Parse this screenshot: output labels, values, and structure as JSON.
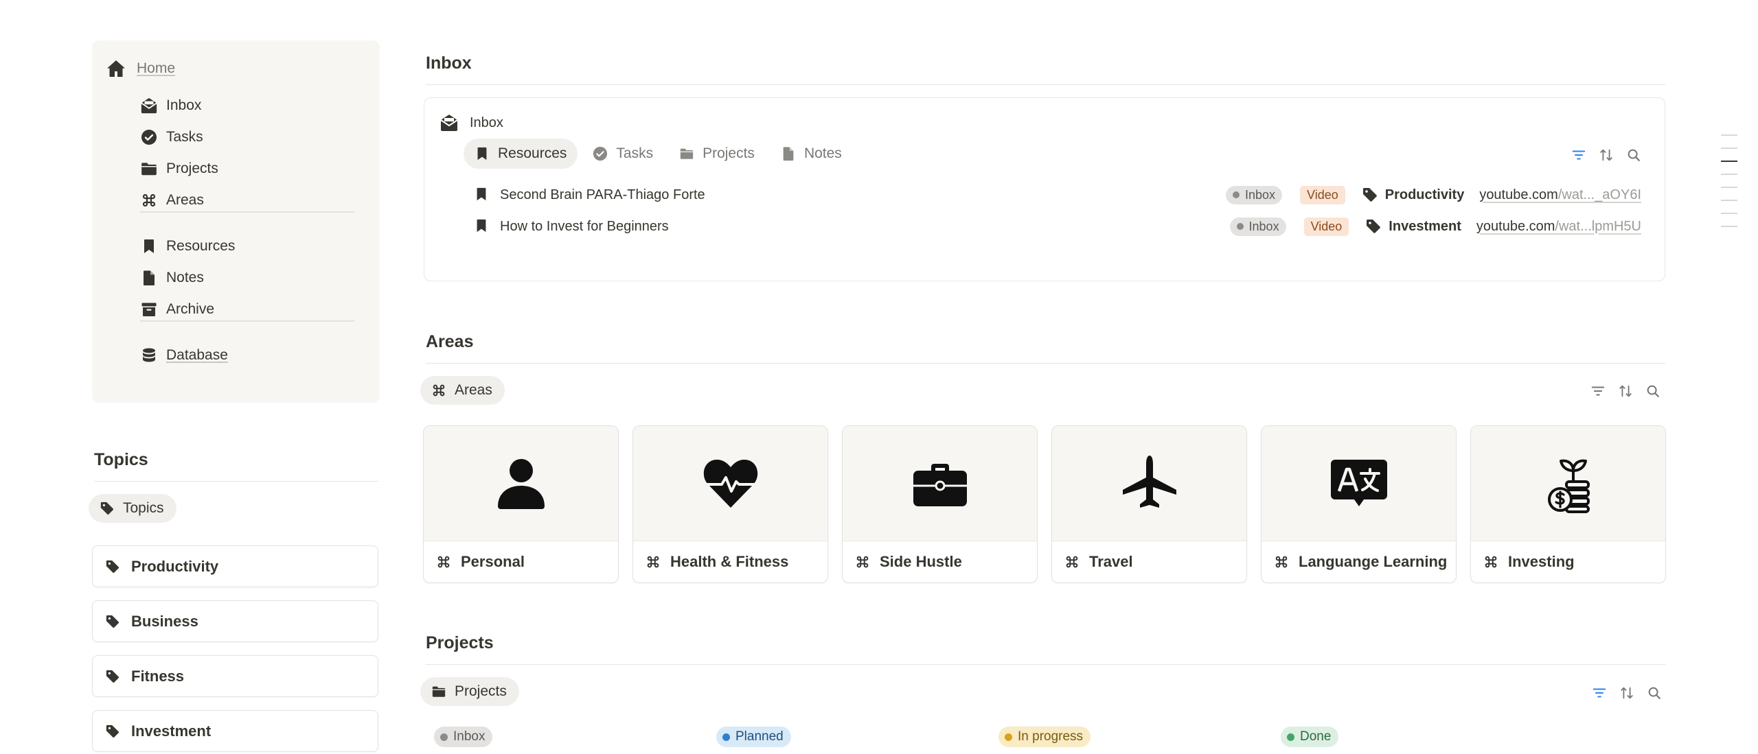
{
  "sidebar": {
    "home": "Home",
    "items": [
      {
        "label": "Inbox",
        "icon": "inbox-icon"
      },
      {
        "label": "Tasks",
        "icon": "check-circle-icon"
      },
      {
        "label": "Projects",
        "icon": "folder-icon"
      },
      {
        "label": "Areas",
        "icon": "command-icon"
      },
      {
        "label": "Resources",
        "icon": "bookmark-icon"
      },
      {
        "label": "Notes",
        "icon": "document-icon"
      },
      {
        "label": "Archive",
        "icon": "archive-icon"
      },
      {
        "label": "Database",
        "icon": "database-icon"
      }
    ]
  },
  "topics": {
    "title": "Topics",
    "view": "Topics",
    "items": [
      "Productivity",
      "Business",
      "Fitness",
      "Investment"
    ]
  },
  "inbox": {
    "title": "Inbox",
    "block_label": "Inbox",
    "tabs": [
      "Resources",
      "Tasks",
      "Projects",
      "Notes"
    ],
    "active_tab": "Resources",
    "rows": [
      {
        "title": "Second Brain PARA-Thiago Forte",
        "status": "Inbox",
        "type": "Video",
        "topic": "Productivity",
        "url_domain": "youtube.com",
        "url_rest": "/wat..._aOY6I"
      },
      {
        "title": "How to Invest for Beginners",
        "status": "Inbox",
        "type": "Video",
        "topic": "Investment",
        "url_domain": "youtube.com",
        "url_rest": "/wat...lpmH5U"
      }
    ]
  },
  "areas": {
    "title": "Areas",
    "view": "Areas",
    "cards": [
      {
        "label": "Personal",
        "icon": "person-icon"
      },
      {
        "label": "Health & Fitness",
        "icon": "heart-pulse-icon"
      },
      {
        "label": "Side Hustle",
        "icon": "briefcase-icon"
      },
      {
        "label": "Travel",
        "icon": "airplane-icon"
      },
      {
        "label": "Languange Learning",
        "icon": "translate-icon"
      },
      {
        "label": "Investing",
        "icon": "plant-coins-icon"
      }
    ]
  },
  "projects": {
    "title": "Projects",
    "view": "Projects",
    "statuses": [
      {
        "label": "Inbox",
        "bg": "#e3e2e0",
        "dot": "#8c8b88",
        "color": "#5a5955"
      },
      {
        "label": "Planned",
        "bg": "#d8e9f7",
        "dot": "#2f7fd1",
        "color": "#1f4f7d"
      },
      {
        "label": "In progress",
        "bg": "#f9ebc4",
        "dot": "#d9a11c",
        "color": "#7a5a11"
      },
      {
        "label": "Done",
        "bg": "#dcefe2",
        "dot": "#44a566",
        "color": "#2c6a41"
      }
    ]
  },
  "colors": {
    "accent_blue": "#2f80ed",
    "text": "#37352f",
    "muted": "#787774"
  }
}
